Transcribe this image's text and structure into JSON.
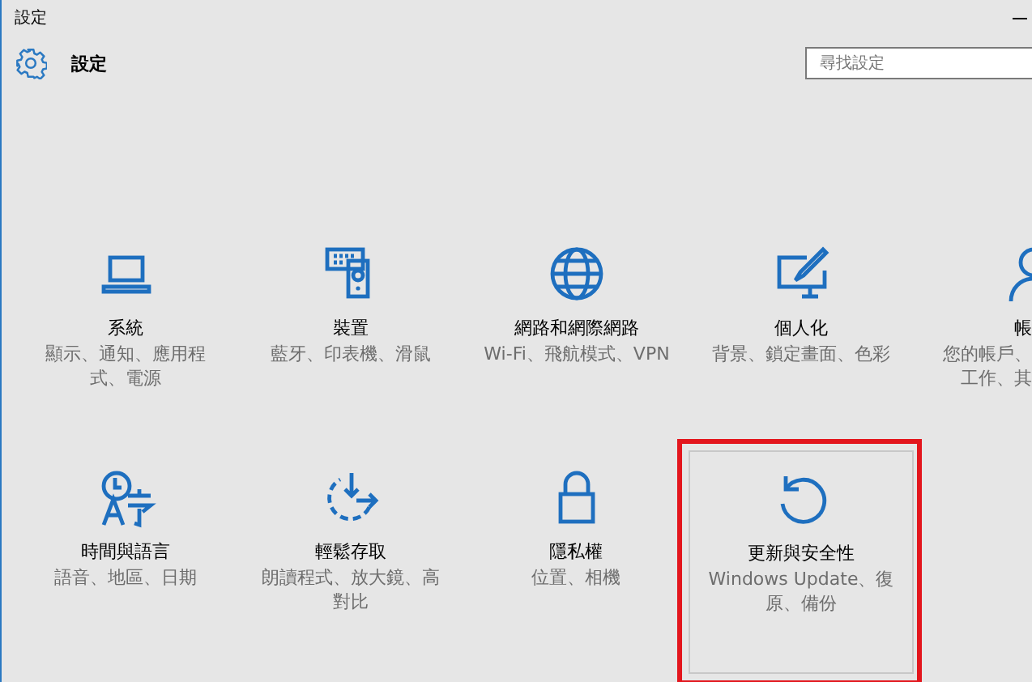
{
  "window": {
    "title": "設定"
  },
  "header": {
    "title": "設定"
  },
  "search": {
    "placeholder": "尋找設定"
  },
  "tiles": [
    {
      "title": "系統",
      "description": "顯示、通知、應用程式、電源",
      "highlighted": false
    },
    {
      "title": "裝置",
      "description": "藍牙、印表機、滑鼠",
      "highlighted": false
    },
    {
      "title": "網路和網際網路",
      "description": "Wi-Fi、飛航模式、VPN",
      "highlighted": false
    },
    {
      "title": "個人化",
      "description": "背景、鎖定畫面、色彩",
      "highlighted": false
    },
    {
      "title": "帳",
      "description": "您的帳戶、工作、其",
      "highlighted": false
    },
    {
      "title": "時間與語言",
      "description": "語音、地區、日期",
      "highlighted": false
    },
    {
      "title": "輕鬆存取",
      "description": "朗讀程式、放大鏡、高對比",
      "highlighted": false
    },
    {
      "title": "隱私權",
      "description": "位置、相機",
      "highlighted": false
    },
    {
      "title": "更新與安全性",
      "description": "Windows Update、復原、備份",
      "highlighted": true
    }
  ]
}
